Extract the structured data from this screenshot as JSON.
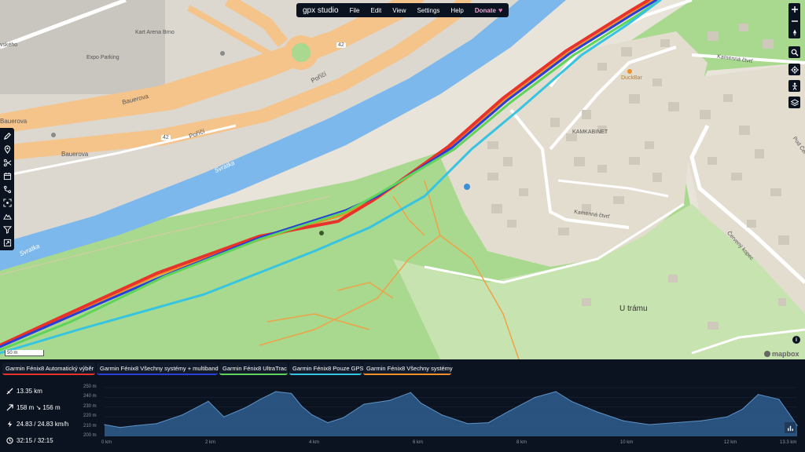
{
  "menu": {
    "logo": "gpx studio",
    "items": [
      "File",
      "Edit",
      "View",
      "Settings",
      "Help"
    ],
    "donate": "Donate"
  },
  "map": {
    "labels": {
      "arena": "Kart Arena Brno",
      "parking": "Expo Parking",
      "skeho": "vského",
      "bauerova1": "Bauerova",
      "bauerova2": "Bauerova",
      "bauerova3": "Bauerova",
      "porici1": "Poříčí",
      "porici2": "Poříčí",
      "svratka1": "Svratka",
      "svratka2": "Svratka",
      "duckbar": "DuckBar",
      "kamkabinet": "KAMKABINET",
      "kamenna1": "Kamenná čtvrť",
      "kamenna2": "Kamenná čtvrť",
      "cervenou": "Pod Červenou",
      "cerveny": "Červený kopec",
      "u_tramu": "U trámu",
      "road42a": "42",
      "road42b": "42"
    },
    "scale_label": "50 m",
    "attribution": "mapbox",
    "info": "i"
  },
  "tabs": [
    {
      "label": "Garmin Fénix8 Automatický výběr",
      "color": "#e8332a"
    },
    {
      "label": "Garmin Fénix8 Všechny systémy + multiband",
      "color": "#2a3ed8"
    },
    {
      "label": "Garmin Fénix8 UltraTrac",
      "color": "#5fd35a"
    },
    {
      "label": "Garmin Fénix8 Pouze GPS",
      "color": "#36c4e0"
    },
    {
      "label": "Garmin Fénix8 Všechny systémy",
      "color": "#f0902a"
    }
  ],
  "stats": {
    "distance": "13.35 km",
    "elevation": "158 m ↘ 156 m",
    "speed": "24.83 / 24.83 km/h",
    "time": "32:15 / 32:15"
  },
  "chart_data": {
    "type": "area",
    "xlabel": "",
    "ylabel": "",
    "y_ticks": [
      "250 m",
      "240 m",
      "230 m",
      "220 m",
      "210 m",
      "200 m"
    ],
    "x_ticks": [
      "0 km",
      "2 km",
      "4 km",
      "6 km",
      "8 km",
      "10 km",
      "12 km",
      "13.3 km"
    ],
    "ylim": [
      200,
      250
    ],
    "xlim": [
      0,
      13.35
    ],
    "x": [
      0,
      0.3,
      0.6,
      1.0,
      1.5,
      2.0,
      2.3,
      2.7,
      3.0,
      3.3,
      3.6,
      3.8,
      4.0,
      4.3,
      4.6,
      5.0,
      5.5,
      5.9,
      6.1,
      6.5,
      7.0,
      7.4,
      7.8,
      8.3,
      8.7,
      9.0,
      9.5,
      10.0,
      10.5,
      11.0,
      11.5,
      12.0,
      12.3,
      12.6,
      13.0,
      13.2,
      13.35
    ],
    "y": [
      212,
      209,
      211,
      213,
      222,
      236,
      220,
      229,
      238,
      246,
      244,
      231,
      222,
      214,
      219,
      233,
      237,
      245,
      234,
      222,
      213,
      214,
      226,
      240,
      246,
      236,
      225,
      216,
      212,
      214,
      216,
      220,
      228,
      243,
      238,
      223,
      211
    ],
    "color": "#2f5f8f"
  },
  "icons": {
    "tools": [
      "pencil-icon",
      "pin-icon",
      "scissors-icon",
      "calendar-icon",
      "merge-icon",
      "scan-icon",
      "mountain-icon",
      "filter-icon",
      "export-icon"
    ],
    "right": [
      "zoom-in-icon",
      "zoom-out-icon",
      "compass-icon",
      "search-icon",
      "locate-icon",
      "street-view-icon",
      "layers-icon"
    ]
  }
}
